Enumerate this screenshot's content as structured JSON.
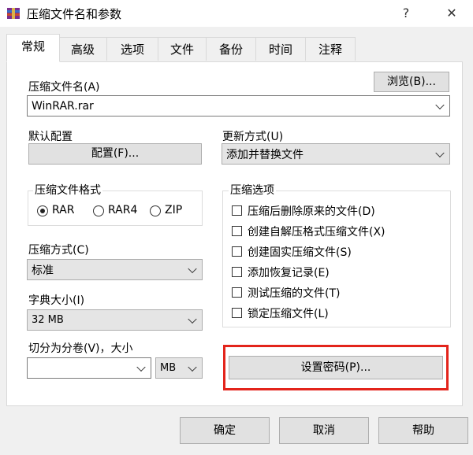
{
  "window": {
    "title": "压缩文件名和参数",
    "help_label": "?",
    "close_label": "✕"
  },
  "tabs": [
    {
      "label": "常规"
    },
    {
      "label": "高级"
    },
    {
      "label": "选项"
    },
    {
      "label": "文件"
    },
    {
      "label": "备份"
    },
    {
      "label": "时间"
    },
    {
      "label": "注释"
    }
  ],
  "archive_name": {
    "label": "压缩文件名(A)",
    "browse_label": "浏览(B)...",
    "value": "WinRAR.rar"
  },
  "default_profile": {
    "label": "默认配置",
    "button_label": "配置(F)..."
  },
  "update_mode": {
    "label": "更新方式(U)",
    "value": "添加并替换文件"
  },
  "archive_format": {
    "title": "压缩文件格式",
    "options": [
      {
        "label": "RAR",
        "selected": true
      },
      {
        "label": "RAR4",
        "selected": false
      },
      {
        "label": "ZIP",
        "selected": false
      }
    ]
  },
  "compression_method": {
    "label": "压缩方式(C)",
    "value": "标准"
  },
  "dictionary_size": {
    "label": "字典大小(I)",
    "value": "32 MB"
  },
  "split_volumes": {
    "label": "切分为分卷(V)，大小",
    "value": "",
    "unit": "MB"
  },
  "archive_options": {
    "title": "压缩选项",
    "items": [
      {
        "label": "压缩后删除原来的文件(D)",
        "checked": false
      },
      {
        "label": "创建自解压格式压缩文件(X)",
        "checked": false
      },
      {
        "label": "创建固实压缩文件(S)",
        "checked": false
      },
      {
        "label": "添加恢复记录(E)",
        "checked": false
      },
      {
        "label": "测试压缩的文件(T)",
        "checked": false
      },
      {
        "label": "锁定压缩文件(L)",
        "checked": false
      }
    ]
  },
  "set_password": {
    "label": "设置密码(P)..."
  },
  "footer": {
    "ok_label": "确定",
    "cancel_label": "取消",
    "help_label": "帮助"
  },
  "colors": {
    "highlight": "#e3241b"
  }
}
